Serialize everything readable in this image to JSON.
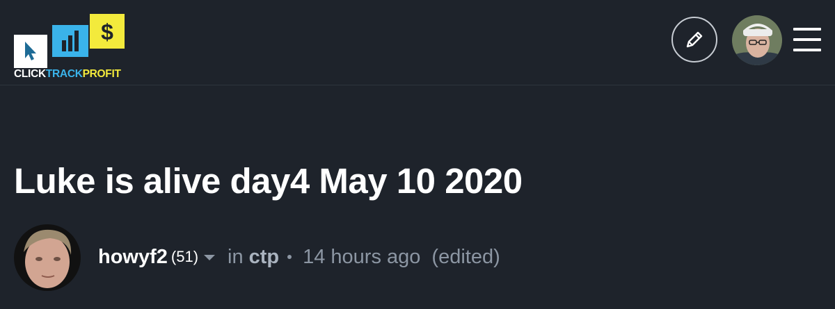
{
  "header": {
    "logo": {
      "word1": "CLICK",
      "word2": "TRACK",
      "word3": "PROFIT",
      "icon": "dollar-sign-icon",
      "colors": {
        "white": "#ffffff",
        "blue": "#3ab3ea",
        "yellow": "#f3ea3c"
      }
    },
    "edit_icon": "pencil-icon",
    "menu_icon": "hamburger-menu-icon"
  },
  "post": {
    "title": "Luke is alive day4 May 10 2020",
    "author": "howyf2",
    "reputation": "(51)",
    "in_label": "in",
    "community": "ctp",
    "time": "14 hours ago",
    "edited": "(edited)"
  },
  "colors": {
    "background": "#1e232b",
    "muted_text": "#8c96a3",
    "title": "#ffffff"
  }
}
